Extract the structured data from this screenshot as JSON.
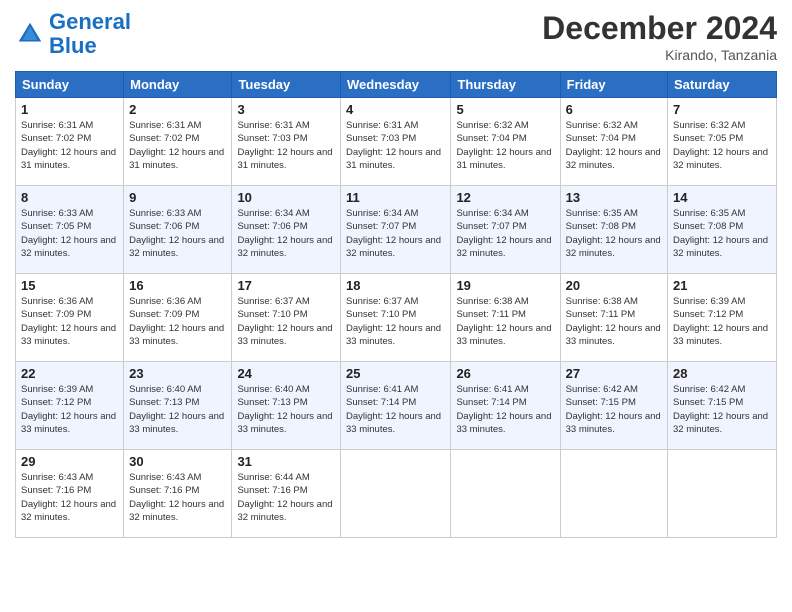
{
  "header": {
    "logo_line1": "General",
    "logo_line2": "Blue",
    "month": "December 2024",
    "location": "Kirando, Tanzania"
  },
  "days_of_week": [
    "Sunday",
    "Monday",
    "Tuesday",
    "Wednesday",
    "Thursday",
    "Friday",
    "Saturday"
  ],
  "weeks": [
    [
      {
        "day": 1,
        "rise": "6:31 AM",
        "set": "7:02 PM",
        "daylight": "12 hours and 31 minutes."
      },
      {
        "day": 2,
        "rise": "6:31 AM",
        "set": "7:02 PM",
        "daylight": "12 hours and 31 minutes."
      },
      {
        "day": 3,
        "rise": "6:31 AM",
        "set": "7:03 PM",
        "daylight": "12 hours and 31 minutes."
      },
      {
        "day": 4,
        "rise": "6:31 AM",
        "set": "7:03 PM",
        "daylight": "12 hours and 31 minutes."
      },
      {
        "day": 5,
        "rise": "6:32 AM",
        "set": "7:04 PM",
        "daylight": "12 hours and 31 minutes."
      },
      {
        "day": 6,
        "rise": "6:32 AM",
        "set": "7:04 PM",
        "daylight": "12 hours and 32 minutes."
      },
      {
        "day": 7,
        "rise": "6:32 AM",
        "set": "7:05 PM",
        "daylight": "12 hours and 32 minutes."
      }
    ],
    [
      {
        "day": 8,
        "rise": "6:33 AM",
        "set": "7:05 PM",
        "daylight": "12 hours and 32 minutes."
      },
      {
        "day": 9,
        "rise": "6:33 AM",
        "set": "7:06 PM",
        "daylight": "12 hours and 32 minutes."
      },
      {
        "day": 10,
        "rise": "6:34 AM",
        "set": "7:06 PM",
        "daylight": "12 hours and 32 minutes."
      },
      {
        "day": 11,
        "rise": "6:34 AM",
        "set": "7:07 PM",
        "daylight": "12 hours and 32 minutes."
      },
      {
        "day": 12,
        "rise": "6:34 AM",
        "set": "7:07 PM",
        "daylight": "12 hours and 32 minutes."
      },
      {
        "day": 13,
        "rise": "6:35 AM",
        "set": "7:08 PM",
        "daylight": "12 hours and 32 minutes."
      },
      {
        "day": 14,
        "rise": "6:35 AM",
        "set": "7:08 PM",
        "daylight": "12 hours and 32 minutes."
      }
    ],
    [
      {
        "day": 15,
        "rise": "6:36 AM",
        "set": "7:09 PM",
        "daylight": "12 hours and 33 minutes."
      },
      {
        "day": 16,
        "rise": "6:36 AM",
        "set": "7:09 PM",
        "daylight": "12 hours and 33 minutes."
      },
      {
        "day": 17,
        "rise": "6:37 AM",
        "set": "7:10 PM",
        "daylight": "12 hours and 33 minutes."
      },
      {
        "day": 18,
        "rise": "6:37 AM",
        "set": "7:10 PM",
        "daylight": "12 hours and 33 minutes."
      },
      {
        "day": 19,
        "rise": "6:38 AM",
        "set": "7:11 PM",
        "daylight": "12 hours and 33 minutes."
      },
      {
        "day": 20,
        "rise": "6:38 AM",
        "set": "7:11 PM",
        "daylight": "12 hours and 33 minutes."
      },
      {
        "day": 21,
        "rise": "6:39 AM",
        "set": "7:12 PM",
        "daylight": "12 hours and 33 minutes."
      }
    ],
    [
      {
        "day": 22,
        "rise": "6:39 AM",
        "set": "7:12 PM",
        "daylight": "12 hours and 33 minutes."
      },
      {
        "day": 23,
        "rise": "6:40 AM",
        "set": "7:13 PM",
        "daylight": "12 hours and 33 minutes."
      },
      {
        "day": 24,
        "rise": "6:40 AM",
        "set": "7:13 PM",
        "daylight": "12 hours and 33 minutes."
      },
      {
        "day": 25,
        "rise": "6:41 AM",
        "set": "7:14 PM",
        "daylight": "12 hours and 33 minutes."
      },
      {
        "day": 26,
        "rise": "6:41 AM",
        "set": "7:14 PM",
        "daylight": "12 hours and 33 minutes."
      },
      {
        "day": 27,
        "rise": "6:42 AM",
        "set": "7:15 PM",
        "daylight": "12 hours and 33 minutes."
      },
      {
        "day": 28,
        "rise": "6:42 AM",
        "set": "7:15 PM",
        "daylight": "12 hours and 32 minutes."
      }
    ],
    [
      {
        "day": 29,
        "rise": "6:43 AM",
        "set": "7:16 PM",
        "daylight": "12 hours and 32 minutes."
      },
      {
        "day": 30,
        "rise": "6:43 AM",
        "set": "7:16 PM",
        "daylight": "12 hours and 32 minutes."
      },
      {
        "day": 31,
        "rise": "6:44 AM",
        "set": "7:16 PM",
        "daylight": "12 hours and 32 minutes."
      },
      null,
      null,
      null,
      null
    ]
  ]
}
